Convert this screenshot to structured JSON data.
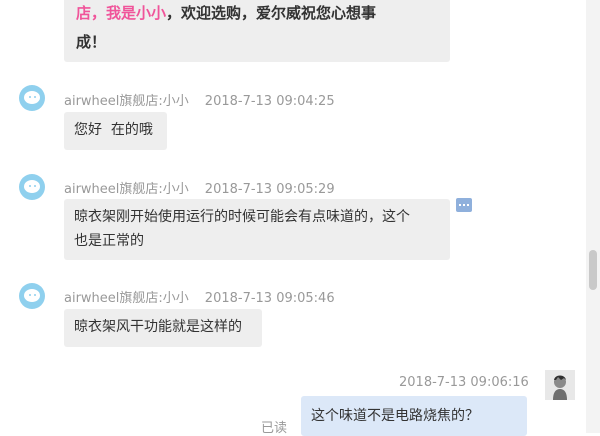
{
  "messages": [
    {
      "highlight": "店，我是小小",
      "line1_rest": "，欢迎选购，爱尔威祝您心想事",
      "line2": "成！"
    },
    {
      "sender": "airwheel旗舰店:小小",
      "time": "2018-7-13 09:04:25",
      "text": "您好  在的哦"
    },
    {
      "sender": "airwheel旗舰店:小小",
      "time": "2018-7-13 09:05:29",
      "line1": "晾衣架刚开始使用运行的时候可能会有点味道的，这个",
      "line2": "也是正常的"
    },
    {
      "sender": "airwheel旗舰店:小小",
      "time": "2018-7-13 09:05:46",
      "text": "晾衣架风干功能就是这样的"
    }
  ],
  "self_message": {
    "time": "2018-7-13 09:06:16",
    "text": "这个味道不是电路烧焦的？",
    "status": "已读"
  },
  "icons": {
    "agent_avatar": "store-agent-avatar-icon",
    "self_avatar": "user-avatar-icon",
    "more": "more-options-icon"
  },
  "colors": {
    "highlight": "#f0549a",
    "agent_bubble": "#eeeeee",
    "self_bubble": "#dce8f8",
    "avatar": "#8fd0ee"
  }
}
